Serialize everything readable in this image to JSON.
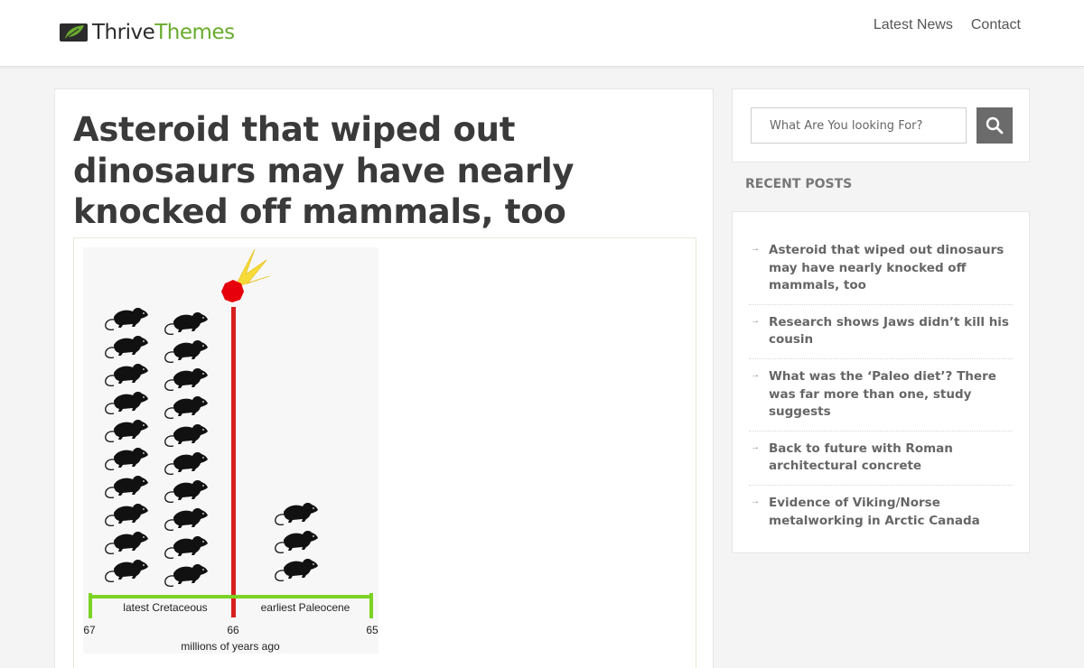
{
  "header": {
    "logo": {
      "part1": "Thrive",
      "part2": "Themes",
      "icon": "leaf-monitor-icon"
    },
    "nav": [
      {
        "label": "Latest News"
      },
      {
        "label": "Contact"
      }
    ]
  },
  "article": {
    "title": "Asteroid that wiped out dinosaurs may have nearly knocked off mammals, too",
    "figure": {
      "period_left": "latest Cretaceous",
      "period_right": "earliest Paleocene",
      "ticks": [
        "67",
        "66",
        "65"
      ],
      "axis_label": "millions of years ago",
      "icon": "rat-silhouette-icon",
      "impact_icon": "asteroid-icon"
    }
  },
  "sidebar": {
    "search": {
      "placeholder": "What Are You looking For?",
      "icon": "search-icon"
    },
    "recent_title": "RECENT POSTS",
    "recent_posts": [
      {
        "title": "Asteroid that wiped out dinosaurs may have nearly knocked off mammals, too"
      },
      {
        "title": "Research shows Jaws didn’t kill his cousin"
      },
      {
        "title": "What was the ‘Paleo diet’? There was far more than one, study suggests"
      },
      {
        "title": "Back to future with Roman architectural concrete"
      },
      {
        "title": "Evidence of Viking/Norse metalworking in Arctic Canada"
      }
    ]
  },
  "colors": {
    "brand_green": "#6aab2e",
    "impact_line": "#d7201e",
    "timeline": "#7bd324",
    "asteroid": "#e6000c",
    "flame": "#f7dc39"
  }
}
